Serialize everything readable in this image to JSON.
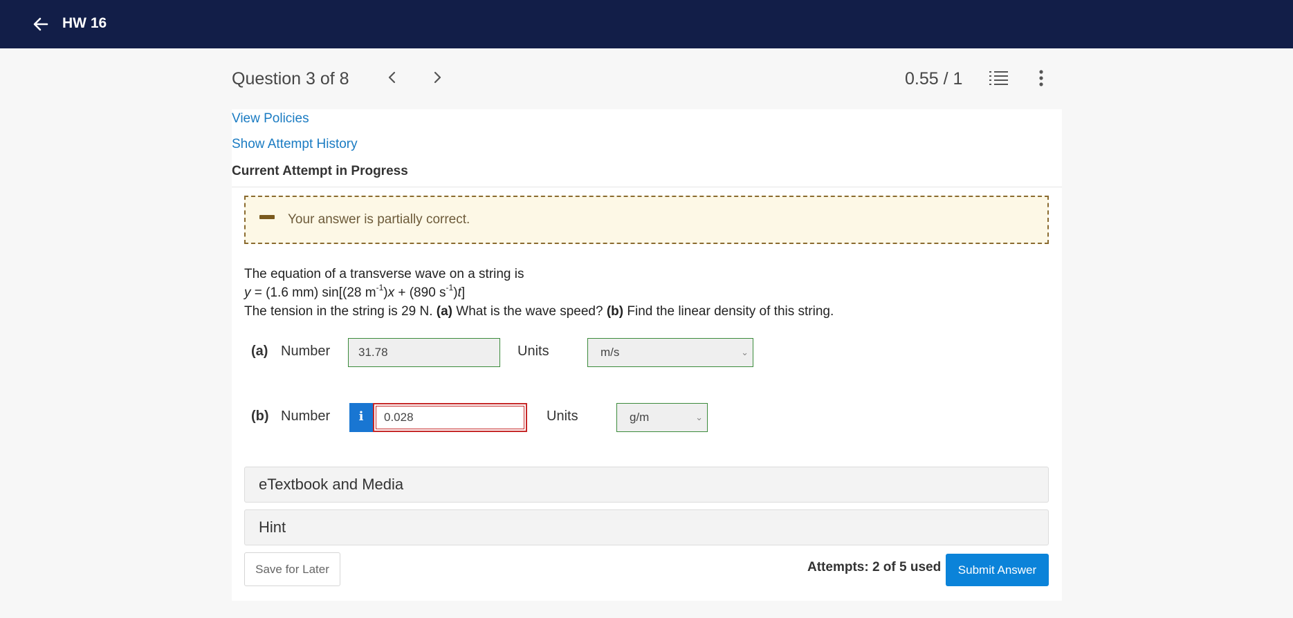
{
  "header": {
    "title": "HW 16"
  },
  "question_nav": {
    "title": "Question 3 of 8",
    "score": "0.55 / 1"
  },
  "links": {
    "view_policies": "View Policies",
    "show_history": "Show Attempt History"
  },
  "attempt_heading": "Current Attempt in Progress",
  "feedback": {
    "text": "Your answer is partially correct.",
    "status_color": "#fdf8e6"
  },
  "question": {
    "line1": "The equation of a transverse wave on a string is",
    "eq_y": "y",
    "eq_part1": " = (1.6 mm) sin[(28 m",
    "eq_exp1": "-1",
    "eq_part2": ")",
    "eq_x": "x",
    "eq_part3": " + (890 s",
    "eq_exp2": "-1",
    "eq_part4": ")",
    "eq_t": "t",
    "eq_part5": "]",
    "line3_a": "The tension in the string is 29 N. ",
    "line3_bold_a": "(a)",
    "line3_b": " What is the wave speed? ",
    "line3_bold_b": "(b)",
    "line3_c": " Find the linear density of this string."
  },
  "part_a": {
    "label": "(a)",
    "number_label": "Number",
    "value": "31.78",
    "units_label": "Units",
    "unit": "m/s"
  },
  "part_b": {
    "label": "(b)",
    "number_label": "Number",
    "info_glyph": "i",
    "value": "0.028",
    "units_label": "Units",
    "unit": "g/m"
  },
  "sections": {
    "etextbook": "eTextbook and Media",
    "hint": "Hint"
  },
  "footer": {
    "save_label": "Save for Later",
    "attempts": "Attempts: 2 of 5 used",
    "submit_label": "Submit Answer"
  },
  "colors": {
    "topbar": "#121e48",
    "link": "#1a7bc2",
    "submit": "#0b83d9",
    "error": "#c62828",
    "correct": "#3a8a3a"
  }
}
